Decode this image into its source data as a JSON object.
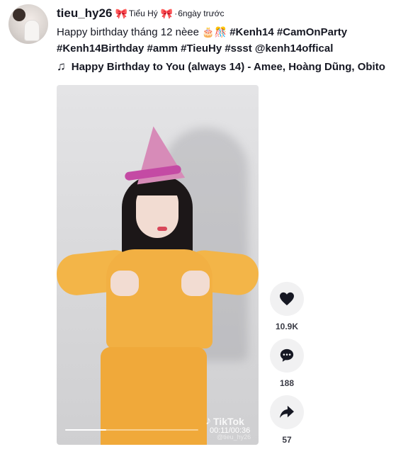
{
  "author": {
    "username": "tieu_hy26",
    "nickname": "Tiểu Hý",
    "separator": "·",
    "posted": "6ngày trước"
  },
  "caption": {
    "text": "Happy birthday tháng 12 nèee",
    "emojis": "🎂🎊",
    "hashtags_line1": [
      "#Kenh14",
      "#CamOnParty"
    ],
    "hashtags_line2": [
      "#Kenh14Birthday",
      "#amm",
      "#TieuHy",
      "#ssst",
      "@kenh14offical"
    ]
  },
  "music": {
    "icon": "music-note-icon",
    "title": "Happy Birthday to You (always 14) - Amee, Hoàng Dũng, Obito"
  },
  "video": {
    "watermark": "TikTok",
    "watermark_user": "@tieu_hy26",
    "time": "00:11/00:36",
    "progress": 0.31
  },
  "actions": {
    "likes": "10.9K",
    "comments": "188",
    "shares": "57"
  },
  "colors": {
    "bow": "#e4437c",
    "text": "#161823",
    "action_bg": "#f1f1f2"
  }
}
